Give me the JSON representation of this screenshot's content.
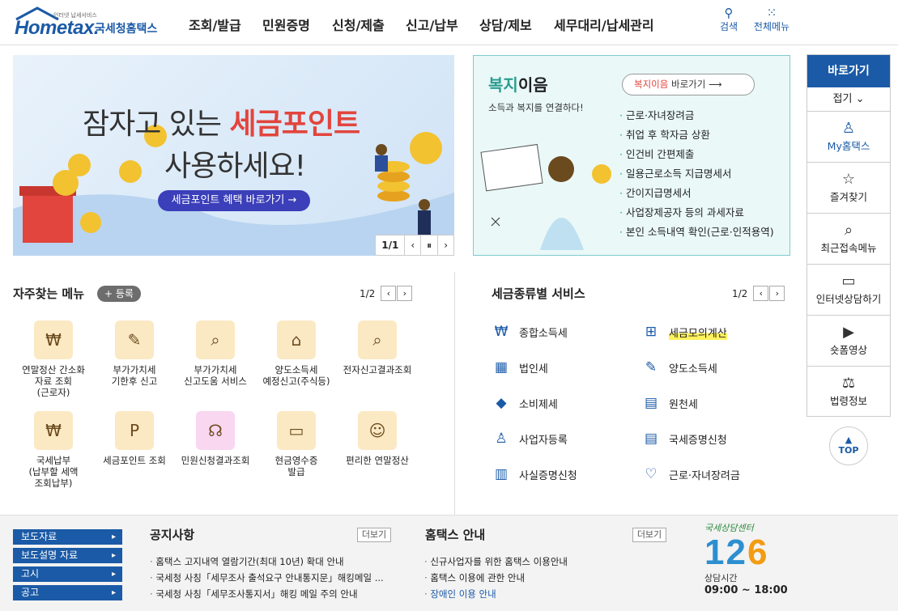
{
  "header": {
    "logo_small": "인터넷 납세서비스",
    "logo_brand": "Hometax.",
    "logo_kr": "국세청홈택스",
    "nav": [
      "조회/발급",
      "민원증명",
      "신청/제출",
      "신고/납부",
      "상담/제보",
      "세무대리/납세관리"
    ],
    "search_label": "검색",
    "menu_label": "전체메뉴"
  },
  "banner": {
    "line1_prefix": "잠자고 있는 ",
    "line1_highlight": "세금포인트",
    "line2": "사용하세요!",
    "button": "세금포인트 혜택 바로가기 →",
    "pager": "1/1"
  },
  "welfare": {
    "title_green": "복지",
    "title_rest": "이음",
    "subtitle": "소득과 복지를 연결하다!",
    "link_red": "복지이음",
    "link_rest": " 바로가기",
    "items": [
      "근로·자녀장려금",
      "취업 후 학자금 상환",
      "인건비 간편제출",
      "일용근로소득 지급명세서",
      "간이지급명세서",
      "사업장제공자 등의 과세자료",
      "본인 소득내역 확인(근로·인적용역)"
    ]
  },
  "favorites": {
    "title": "자주찾는 메뉴",
    "register": "+ 등록",
    "page": "1/2",
    "items": [
      {
        "label": "연말정산 간소화\n자료 조회\n(근로자)",
        "icon": "money-bag-icon"
      },
      {
        "label": "부가가치세\n기한후 신고",
        "icon": "vat-icon"
      },
      {
        "label": "부가가치세\n신고도움 서비스",
        "icon": "document-search-icon"
      },
      {
        "label": "양도소득세\n예정신고(주식등)",
        "icon": "house-pen-icon"
      },
      {
        "label": "전자신고결과조회",
        "icon": "won-search-icon"
      },
      {
        "label": "국세납부\n(납부할 세액\n조회납부)",
        "icon": "money-bag-icon"
      },
      {
        "label": "세금포인트 조회",
        "icon": "tax-point-icon"
      },
      {
        "label": "민원신청결과조회",
        "icon": "headset-icon"
      },
      {
        "label": "현금영수증\n발급",
        "icon": "receipt-icon"
      },
      {
        "label": "편리한 연말정산",
        "icon": "smile-won-icon"
      }
    ]
  },
  "tax_services": {
    "title": "세금종류별 서비스",
    "page": "1/2",
    "items": [
      "종합소득세",
      "세금모의계산",
      "법인세",
      "양도소득세",
      "소비제세",
      "원천세",
      "사업자등록",
      "국세증명신청",
      "사실증명신청",
      "근로·자녀장려금"
    ]
  },
  "quick": {
    "title": "바로가기",
    "fold": "접기 ⌄",
    "items": [
      "My홈택스",
      "즐겨찾기",
      "최근접속메뉴",
      "인터넷상담하기",
      "숏폼영상",
      "법령정보"
    ],
    "top": "TOP"
  },
  "footer": {
    "buttons": [
      "보도자료",
      "보도설명 자료",
      "고시",
      "공고"
    ],
    "notice_title": "공지사항",
    "notice_more": "더보기",
    "notices": [
      "홈택스 고지내역 열람기간(최대 10년) 확대 안내",
      "국세청 사칭「세무조사 출석요구 안내통지문」해킹메일 ...",
      "국세청 사칭「세무조사통지서」해킹 메일 주의 안내"
    ],
    "guide_title": "홈택스 안내",
    "guide_more": "더보기",
    "guides": [
      "신규사업자를 위한 홈택스 이용안내",
      "홈택스 이용에 관한 안내",
      "장애인 이용 안내"
    ],
    "cs_title": "국세상담센터",
    "cs_number_a": "12",
    "cs_number_b": "6",
    "cs_hours_label": "상담시간",
    "cs_hours": "09:00 ~ 18:00"
  }
}
